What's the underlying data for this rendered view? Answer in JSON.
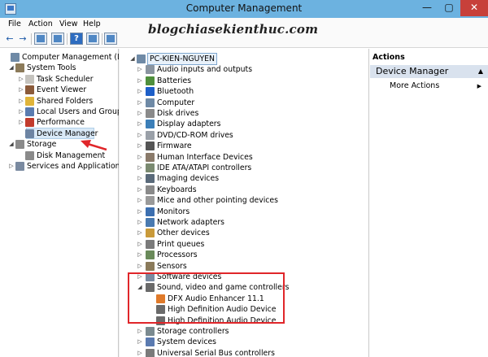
{
  "window": {
    "title": "Computer Management",
    "min": "—",
    "max": "▢",
    "close": "✕"
  },
  "menu": [
    "File",
    "Action",
    "View",
    "Help"
  ],
  "watermark": "blogchiasekienthuc.com",
  "left_tree": [
    {
      "label": "Computer Management (Local",
      "arrow": "",
      "icon": "#6f8aa6",
      "level": 0,
      "id": "computer-management"
    },
    {
      "label": "System Tools",
      "arrow": "◢",
      "icon": "#8c7b5a",
      "level": 1,
      "id": "system-tools"
    },
    {
      "label": "Task Scheduler",
      "arrow": "▷",
      "icon": "#c5c3be",
      "level": 2,
      "id": "task-scheduler"
    },
    {
      "label": "Event Viewer",
      "arrow": "▷",
      "icon": "#8b5a3a",
      "level": 2,
      "id": "event-viewer"
    },
    {
      "label": "Shared Folders",
      "arrow": "▷",
      "icon": "#e0b43a",
      "level": 2,
      "id": "shared-folders"
    },
    {
      "label": "Local Users and Groups",
      "arrow": "▷",
      "icon": "#5a7cb0",
      "level": 2,
      "id": "local-users-and-groups"
    },
    {
      "label": "Performance",
      "arrow": "▷",
      "icon": "#c23b2c",
      "level": 2,
      "id": "performance"
    },
    {
      "label": "Device Manager",
      "arrow": "",
      "icon": "#6d84a3",
      "level": 2,
      "id": "device-manager"
    },
    {
      "label": "Storage",
      "arrow": "◢",
      "icon": "#8a8a8a",
      "level": 1,
      "id": "storage"
    },
    {
      "label": "Disk Management",
      "arrow": "",
      "icon": "#8a8a8a",
      "level": 2,
      "id": "disk-management"
    },
    {
      "label": "Services and Applications",
      "arrow": "▷",
      "icon": "#7a8aa0",
      "level": 1,
      "id": "services-and-applications"
    }
  ],
  "device_tree": {
    "root": "PC-KIEN-NGUYEN",
    "root_arrow": "◢",
    "items": [
      {
        "label": "Audio inputs and outputs",
        "arrow": "▷",
        "icon": "#8a94a0",
        "level": 1
      },
      {
        "label": "Batteries",
        "arrow": "▷",
        "icon": "#4f8f3c",
        "level": 1
      },
      {
        "label": "Bluetooth",
        "arrow": "▷",
        "icon": "#1e5fc8",
        "level": 1
      },
      {
        "label": "Computer",
        "arrow": "▷",
        "icon": "#6f8aa6",
        "level": 1
      },
      {
        "label": "Disk drives",
        "arrow": "▷",
        "icon": "#8a8a8a",
        "level": 1
      },
      {
        "label": "Display adapters",
        "arrow": "▷",
        "icon": "#3c7fb8",
        "level": 1
      },
      {
        "label": "DVD/CD-ROM drives",
        "arrow": "▷",
        "icon": "#9aa0a8",
        "level": 1
      },
      {
        "label": "Firmware",
        "arrow": "▷",
        "icon": "#555555",
        "level": 1
      },
      {
        "label": "Human Interface Devices",
        "arrow": "▷",
        "icon": "#8a7a6a",
        "level": 1
      },
      {
        "label": "IDE ATA/ATAPI controllers",
        "arrow": "▷",
        "icon": "#7a8a70",
        "level": 1
      },
      {
        "label": "Imaging devices",
        "arrow": "▷",
        "icon": "#5a6a7a",
        "level": 1
      },
      {
        "label": "Keyboards",
        "arrow": "▷",
        "icon": "#8a8a8a",
        "level": 1
      },
      {
        "label": "Mice and other pointing devices",
        "arrow": "▷",
        "icon": "#9a9a9a",
        "level": 1
      },
      {
        "label": "Monitors",
        "arrow": "▷",
        "icon": "#3c6fb0",
        "level": 1
      },
      {
        "label": "Network adapters",
        "arrow": "▷",
        "icon": "#4a7ab0",
        "level": 1
      },
      {
        "label": "Other devices",
        "arrow": "▷",
        "icon": "#c99a3a",
        "level": 1
      },
      {
        "label": "Print queues",
        "arrow": "▷",
        "icon": "#7a7a7a",
        "level": 1
      },
      {
        "label": "Processors",
        "arrow": "▷",
        "icon": "#6a8a5a",
        "level": 1
      },
      {
        "label": "Sensors",
        "arrow": "▷",
        "icon": "#8a7a5a",
        "level": 1
      },
      {
        "label": "Software devices",
        "arrow": "▷",
        "icon": "#7a8aa0",
        "level": 1
      },
      {
        "label": "Sound, video and game controllers",
        "arrow": "◢",
        "icon": "#6a6a6a",
        "level": 1
      },
      {
        "label": "DFX Audio Enhancer 11.1",
        "arrow": "",
        "icon": "#e07a2a",
        "level": 2
      },
      {
        "label": "High Definition Audio Device",
        "arrow": "",
        "icon": "#6a6a6a",
        "level": 2
      },
      {
        "label": "High Definition Audio Device",
        "arrow": "",
        "icon": "#6a6a6a",
        "level": 2
      },
      {
        "label": "Storage controllers",
        "arrow": "▷",
        "icon": "#7a8a90",
        "level": 1
      },
      {
        "label": "System devices",
        "arrow": "▷",
        "icon": "#5a7ab0",
        "level": 1
      },
      {
        "label": "Universal Serial Bus controllers",
        "arrow": "▷",
        "icon": "#7a7a7a",
        "level": 1
      }
    ]
  },
  "actions": {
    "header": "Actions",
    "section": "Device Manager",
    "section_caret": "▲",
    "more": "More Actions",
    "more_caret": "▶"
  },
  "colors": {
    "titlebar": "#6cb2e0",
    "close": "#c7403a",
    "highlight": "#e0262a",
    "selection": "#d9e9f7"
  }
}
